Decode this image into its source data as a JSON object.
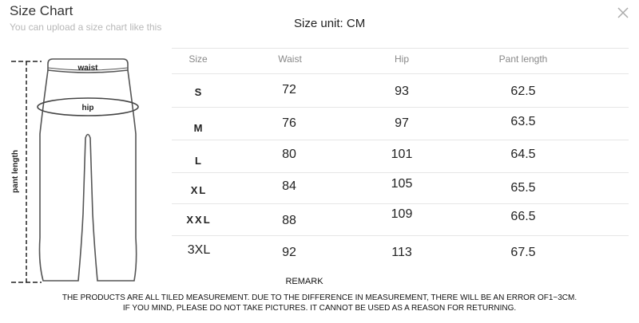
{
  "header": {
    "title": "Size Chart",
    "subtitle": "You can upload a size chart like this",
    "size_unit": "Size unit: CM"
  },
  "illustration": {
    "labels": {
      "waist": "waist",
      "hip": "hip",
      "length": "pant length"
    }
  },
  "table": {
    "columns": [
      "Size",
      "Waist",
      "Hip",
      "Pant length"
    ],
    "rows": [
      {
        "size": "S",
        "waist": "72",
        "hip": "93",
        "length": "62.5"
      },
      {
        "size": "M",
        "waist": "76",
        "hip": "97",
        "length": "63.5"
      },
      {
        "size": "L",
        "waist": "80",
        "hip": "101",
        "length": "64.5"
      },
      {
        "size": "XL",
        "waist": "84",
        "hip": "105",
        "length": "65.5"
      },
      {
        "size": "XXL",
        "waist": "88",
        "hip": "109",
        "length": "66.5"
      },
      {
        "size": "3XL",
        "waist": "92",
        "hip": "113",
        "length": "67.5"
      }
    ]
  },
  "footer": {
    "remark": "REMARK",
    "line1": "THE PRODUCTS ARE ALL TILED MEASUREMENT. DUE TO THE DIFFERENCE IN MEASUREMENT, THERE WILL BE AN ERROR OF1~3CM.",
    "line2": "IF YOU MIND, PLEASE DO NOT TAKE PICTURES. IT CANNOT BE USED AS A REASON FOR RETURNING."
  },
  "icons": {
    "close": "close-icon"
  }
}
